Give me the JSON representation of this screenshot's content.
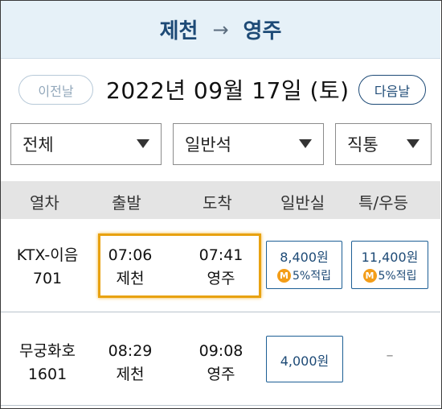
{
  "header": {
    "from": "제천",
    "arrow": "→",
    "to": "영주"
  },
  "date_nav": {
    "prev_label": "이전날",
    "date": "2022년 09월 17일 (토)",
    "next_label": "다음날"
  },
  "filters": [
    {
      "value": "전체"
    },
    {
      "value": "일반석"
    },
    {
      "value": "직통"
    }
  ],
  "columns": [
    "열차",
    "출발",
    "도착",
    "일반실",
    "특/우등"
  ],
  "trains": [
    {
      "name": "KTX-이음",
      "number": "701",
      "dep_time": "07:06",
      "dep_station": "제천",
      "arr_time": "07:41",
      "arr_station": "영주",
      "standard_fare": "8,400원",
      "standard_mileage": "5%적립",
      "special_fare": "11,400원",
      "special_mileage": "5%적립",
      "highlighted": true
    },
    {
      "name": "무궁화호",
      "number": "1601",
      "dep_time": "08:29",
      "dep_station": "제천",
      "arr_time": "09:08",
      "arr_station": "영주",
      "standard_fare": "4,000원",
      "special_fare": "–"
    }
  ],
  "mileage_badge": "M",
  "colors": {
    "header_bg": "#e6f1f8",
    "accent": "#1d4a76",
    "highlight": "#e8a211",
    "mileage": "#f39d18"
  }
}
